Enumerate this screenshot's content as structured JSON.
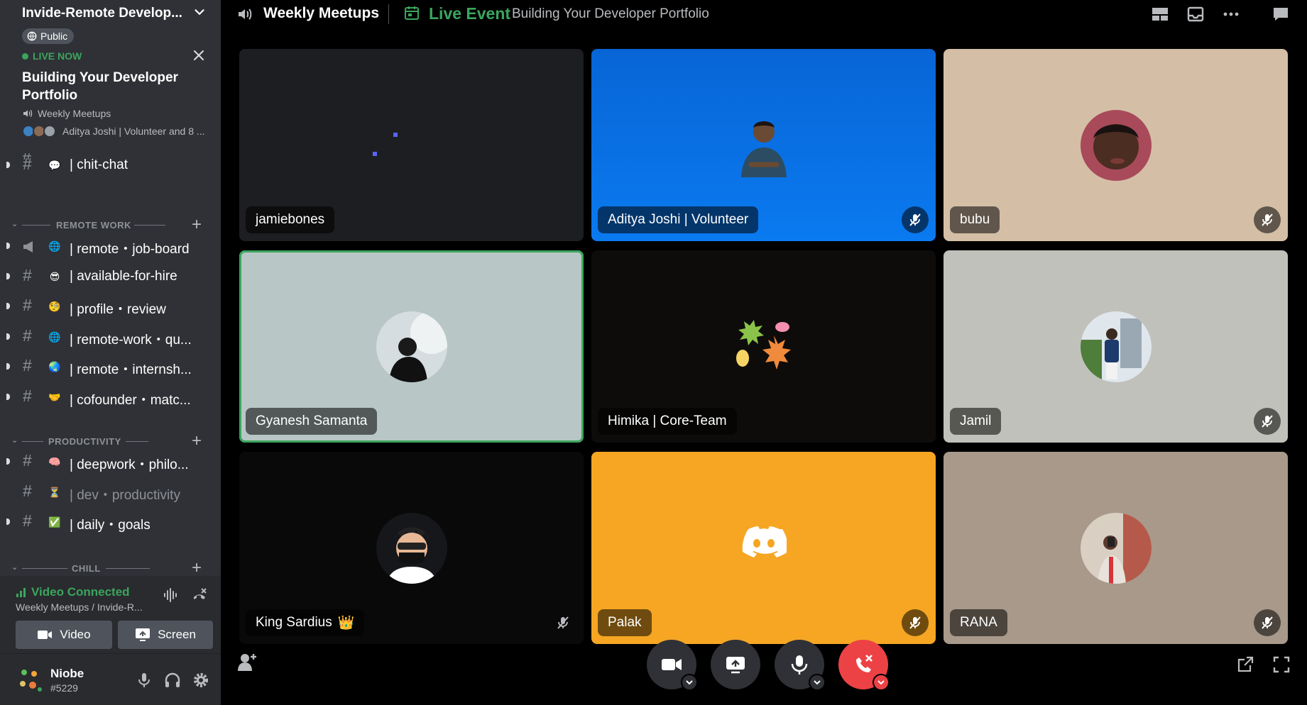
{
  "server": {
    "name": "Invide-Remote Develop...",
    "visibility": "Public"
  },
  "live_event": {
    "status": "LIVE NOW",
    "title": "Building Your Developer Portfolio",
    "channel": "Weekly Meetups",
    "attendees": "Aditya Joshi | Volunteer and 8 ..."
  },
  "channels": [
    {
      "name": "| chit-chat",
      "emoji": "💬",
      "emoji_bg": "#2f3136",
      "muted": false
    },
    {
      "name": "| remote・job-board",
      "emoji": "🌐",
      "emoji_bg": "#2f3136",
      "muted": false,
      "icon": "megaphone-icon"
    },
    {
      "name": "| available-for-hire",
      "emoji": "😎",
      "emoji_bg": "#2f3136",
      "muted": false
    },
    {
      "name": "| profile・review",
      "emoji": "🧐",
      "emoji_bg": "#2f3136",
      "muted": false
    },
    {
      "name": "| remote-work・qu...",
      "emoji": "🌐",
      "emoji_bg": "#2f3136",
      "muted": false
    },
    {
      "name": "| remote・internsh...",
      "emoji": "🌏",
      "emoji_bg": "#2f3136",
      "muted": false
    },
    {
      "name": "| cofounder・matc...",
      "emoji": "🤝",
      "emoji_bg": "#2f3136",
      "muted": false
    },
    {
      "name": "| deepwork・philo...",
      "emoji": "🧠",
      "emoji_bg": "#2f3136",
      "muted": false
    },
    {
      "name": "| dev・productivity",
      "emoji": "⏳",
      "emoji_bg": "#2f3136",
      "muted": true
    },
    {
      "name": "| daily・goals",
      "emoji": "✅",
      "emoji_bg": "#2f3136",
      "muted": false
    }
  ],
  "categories": {
    "remote_work": "REMOTE WORK",
    "productivity": "PRODUCTIVITY",
    "chill": "CHILL"
  },
  "voice": {
    "status": "Video Connected",
    "location": "Weekly Meetups / Invide-R...",
    "video_label": "Video",
    "screen_label": "Screen"
  },
  "user": {
    "name": "Niobe",
    "tag": "#5229"
  },
  "topbar": {
    "channel": "Weekly Meetups",
    "live_label": "Live Event",
    "event_title": "Building Your Developer Portfolio"
  },
  "participants": [
    {
      "name": "jamiebones",
      "muted": false,
      "speaking": false
    },
    {
      "name": "Aditya Joshi | Volunteer",
      "muted": true,
      "speaking": false
    },
    {
      "name": "bubu",
      "muted": true,
      "speaking": false
    },
    {
      "name": "Gyanesh Samanta",
      "muted": false,
      "speaking": true
    },
    {
      "name": "Himika | Core-Team",
      "muted": false,
      "speaking": false
    },
    {
      "name": "Jamil",
      "muted": true,
      "speaking": false
    },
    {
      "name": "King Sardius",
      "badge": "👑",
      "muted": true,
      "speaking": false
    },
    {
      "name": "Palak",
      "muted": true,
      "speaking": false
    },
    {
      "name": "RANA",
      "muted": true,
      "speaking": false
    }
  ],
  "colors": {
    "accent_green": "#3ba55d",
    "danger_red": "#ed4245",
    "sidebar_bg": "#2f3136",
    "discord_blurple": "#5865f2"
  }
}
